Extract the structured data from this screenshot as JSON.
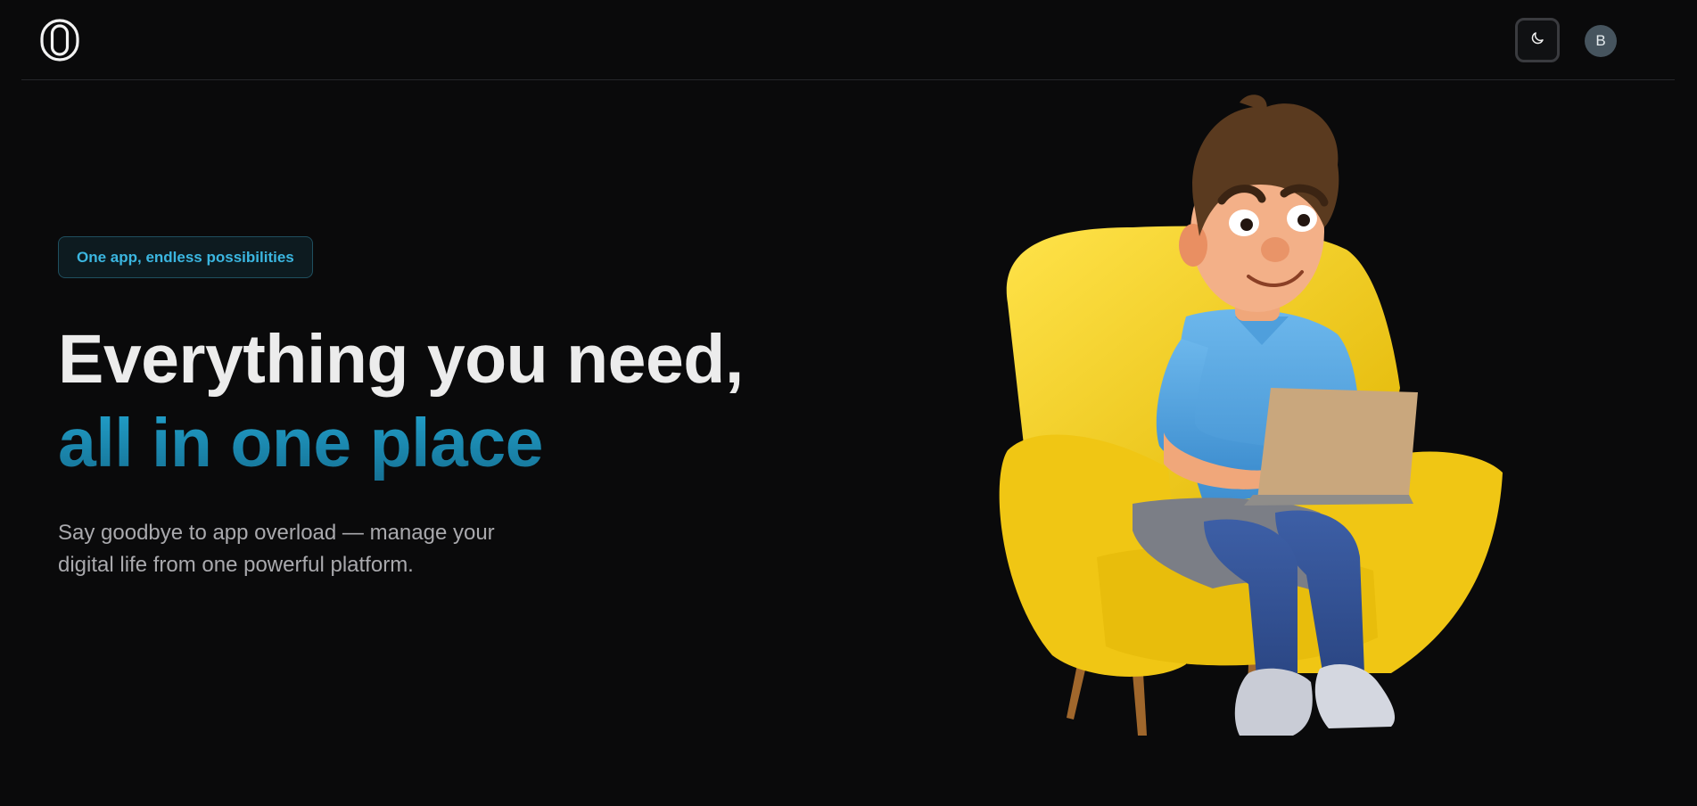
{
  "header": {
    "logo_icon": "logo-icon",
    "theme_toggle_icon": "moon-icon",
    "avatar_initial": "B"
  },
  "hero": {
    "badge": "One app, endless possibilities",
    "headline_line1": "Everything you need,",
    "headline_line2": "all in one place",
    "subtext_line1": "Say goodbye to app overload — manage your",
    "subtext_line2": "digital life from one powerful platform.",
    "illustration": "person-on-armchair-with-laptop-illustration"
  },
  "colors": {
    "background": "#0a0a0b",
    "accent": "#22a4cf",
    "badge_text": "#3bb6e0"
  }
}
